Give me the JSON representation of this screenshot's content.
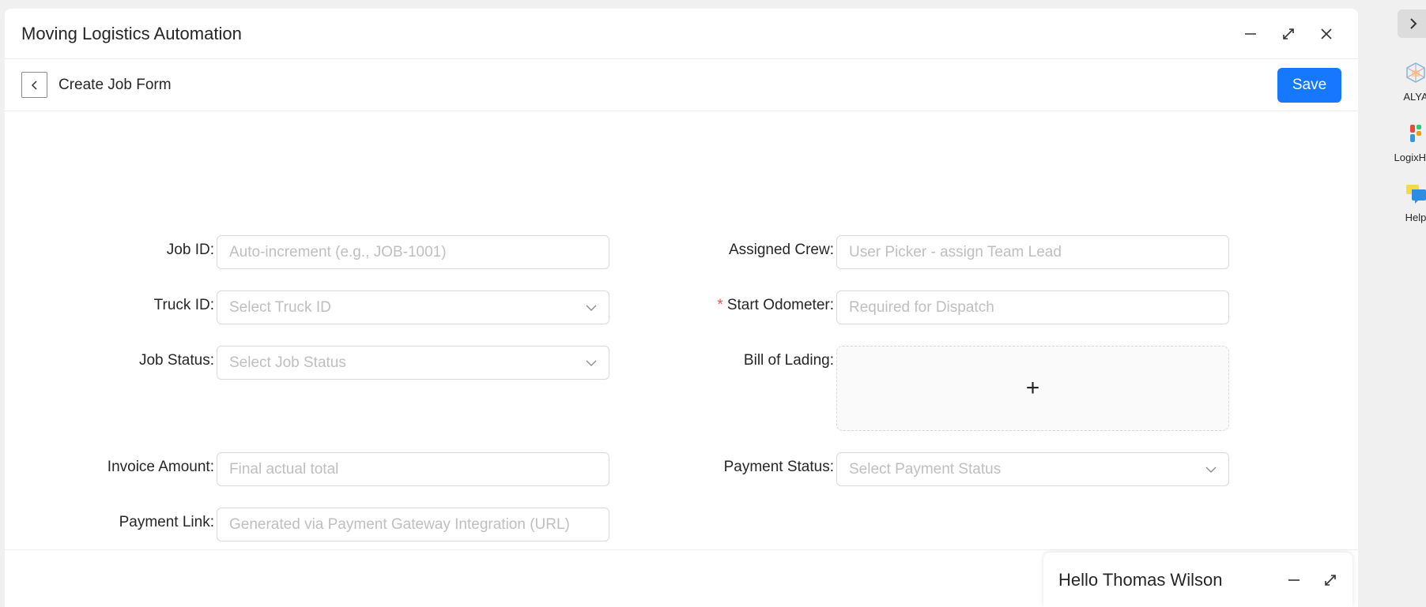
{
  "window": {
    "title": "Moving Logistics Automation"
  },
  "header": {
    "form_title": "Create Job Form",
    "save_label": "Save"
  },
  "form": {
    "job_id": {
      "label": "Job ID",
      "placeholder": "Auto-increment (e.g., JOB-1001)"
    },
    "truck_id": {
      "label": "Truck ID",
      "placeholder": "Select Truck ID"
    },
    "job_status": {
      "label": "Job Status",
      "placeholder": "Select Job Status"
    },
    "invoice_amount": {
      "label": "Invoice Amount",
      "placeholder": "Final actual total"
    },
    "payment_link": {
      "label": "Payment Link",
      "placeholder": "Generated via Payment Gateway Integration (URL)"
    },
    "assigned_crew": {
      "label": "Assigned Crew",
      "placeholder": "User Picker - assign Team Lead"
    },
    "start_odometer": {
      "label": "Start Odometer",
      "placeholder": "Required for Dispatch",
      "required_mark": "*"
    },
    "bill_of_lading": {
      "label": "Bill of Lading",
      "upload_glyph": "+"
    },
    "payment_status": {
      "label": "Payment Status",
      "placeholder": "Select Payment Status"
    },
    "label_suffix": ":"
  },
  "sidebar": {
    "items": [
      {
        "label": "ALYA",
        "icon": "alya-cube-icon"
      },
      {
        "label": "LogixHub",
        "icon": "logixhub-icon"
      },
      {
        "label": "Help",
        "icon": "help-chat-icon"
      }
    ]
  },
  "chat": {
    "greeting": "Hello Thomas Wilson"
  },
  "colors": {
    "primary": "#1677ff",
    "required": "#ff4d4f",
    "placeholder": "#bfbfbf"
  }
}
